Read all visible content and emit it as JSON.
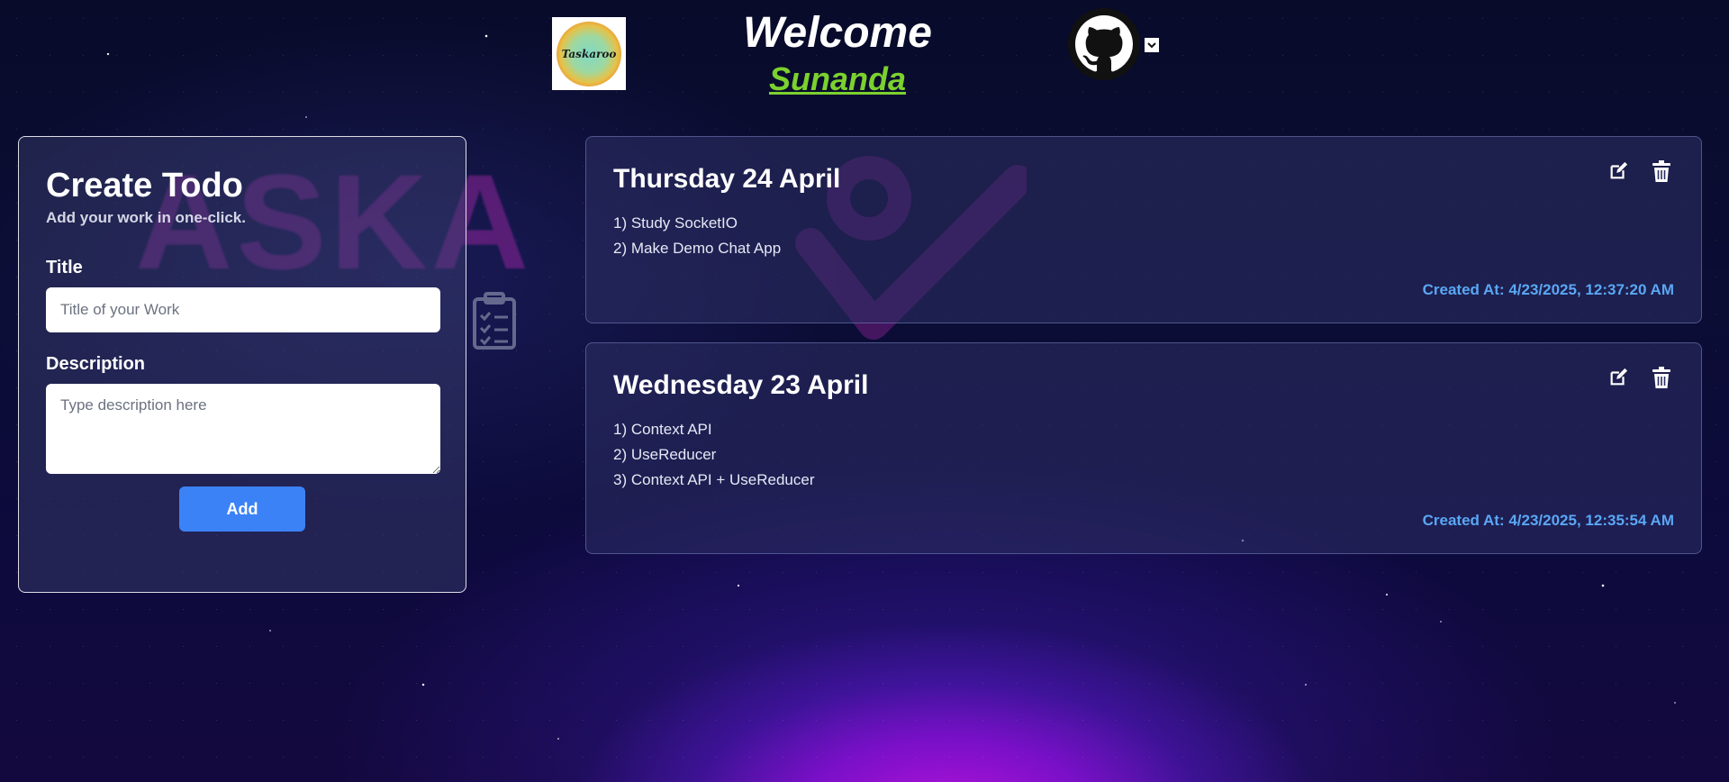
{
  "header": {
    "logo_text": "Taskaroo",
    "welcome": "Welcome",
    "user_name": "Sunanda"
  },
  "create": {
    "title": "Create Todo",
    "subtitle": "Add your work in one-click.",
    "title_label": "Title",
    "title_placeholder": "Title of your Work",
    "description_label": "Description",
    "description_placeholder": "Type description here",
    "add_label": "Add"
  },
  "todos": [
    {
      "title": "Thursday 24 April",
      "lines": [
        "1) Study SocketIO",
        "2) Make Demo Chat App"
      ],
      "created": "Created At: 4/23/2025, 12:37:20 AM"
    },
    {
      "title": "Wednesday 23 April",
      "lines": [
        "1) Context API",
        "2) UseReducer",
        "3) Context API + UseReducer"
      ],
      "created": "Created At: 4/23/2025, 12:35:54 AM"
    }
  ],
  "colors": {
    "accent_green": "#7bd12e",
    "button_blue": "#3b82f6",
    "created_blue": "#5aa7f5"
  },
  "icons": {
    "edit": "edit-icon",
    "delete": "trash-icon",
    "github": "github-icon",
    "dropdown": "chevron-down-icon"
  }
}
